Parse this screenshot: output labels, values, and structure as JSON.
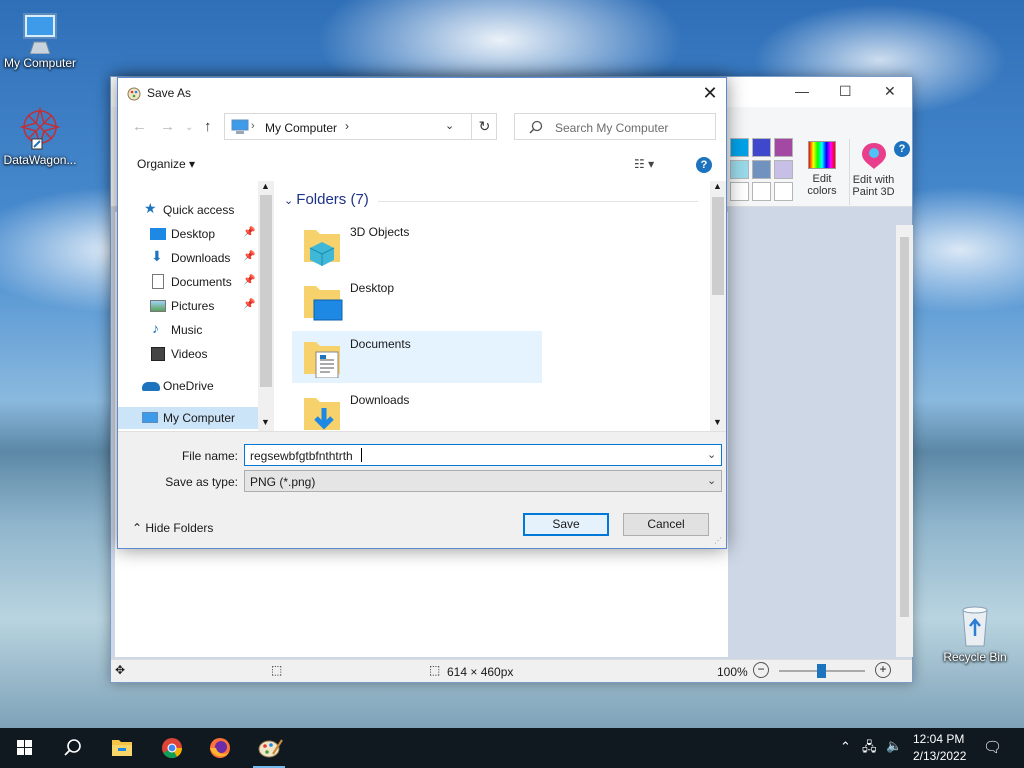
{
  "desktop": {
    "icons": [
      {
        "label": "My Computer"
      },
      {
        "label": "DataWagon..."
      },
      {
        "label": "Recycle Bin"
      }
    ]
  },
  "paint": {
    "ribbon_edit_colors": "Edit colors",
    "ribbon_edit_colors_line1": "Edit",
    "ribbon_edit_colors_line2": "colors",
    "ribbon_paint3d_line1": "Edit with",
    "ribbon_paint3d_line2": "Paint 3D",
    "help": "?",
    "status": {
      "dimensions": "614 × 460px",
      "zoom": "100%"
    },
    "swatch_colors": [
      "#00a2e8",
      "#3f48cc",
      "#a349a4",
      "#99d9ea",
      "#7092be",
      "#c8bfe7",
      "#ffffff",
      "#ffffff",
      "#ffffff"
    ]
  },
  "dialog": {
    "title": "Save As",
    "close": "✕",
    "address": {
      "location": "My Computer"
    },
    "search": {
      "placeholder": "Search My Computer"
    },
    "toolbar": {
      "organize": "Organize ▾",
      "help": "?"
    },
    "nav": {
      "items": [
        {
          "label": "Quick access",
          "pinned": false
        },
        {
          "label": "Desktop",
          "pinned": true
        },
        {
          "label": "Downloads",
          "pinned": true
        },
        {
          "label": "Documents",
          "pinned": true
        },
        {
          "label": "Pictures",
          "pinned": true
        },
        {
          "label": "Music",
          "pinned": false
        },
        {
          "label": "Videos",
          "pinned": false
        },
        {
          "label": "OneDrive",
          "pinned": false
        },
        {
          "label": "My Computer",
          "pinned": false
        }
      ]
    },
    "content": {
      "group": "Folders (7)",
      "folders": [
        {
          "label": "3D Objects"
        },
        {
          "label": "Desktop"
        },
        {
          "label": "Documents"
        },
        {
          "label": "Downloads"
        }
      ]
    },
    "form": {
      "file_name_label": "File name:",
      "file_name_value": "regsewbfgtbfnthtrth",
      "save_type_label": "Save as type:",
      "save_type_value": "PNG (*.png)",
      "hide_folders": "Hide Folders",
      "save": "Save",
      "cancel": "Cancel"
    }
  },
  "taskbar": {
    "time": "12:04 PM",
    "date": "2/13/2022"
  }
}
